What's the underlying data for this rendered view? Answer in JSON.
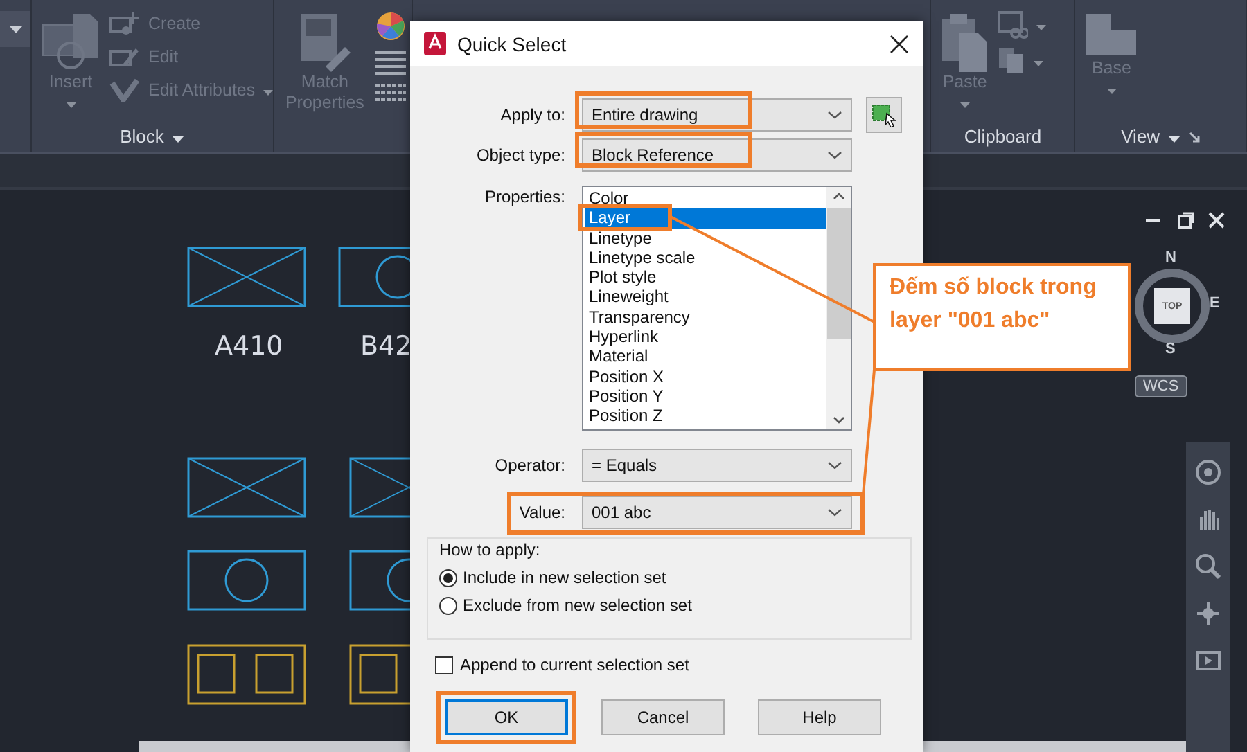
{
  "ribbon": {
    "panels": [
      {
        "title": "Block",
        "has_menu": true,
        "launcher": false,
        "items": [
          {
            "kind": "large",
            "label": "Insert",
            "has_menu": true
          },
          {
            "kind": "small",
            "label": "Create",
            "has_menu": false
          },
          {
            "kind": "small",
            "label": "Edit",
            "has_menu": false
          },
          {
            "kind": "small",
            "label": "Edit Attributes",
            "has_menu": true
          }
        ]
      },
      {
        "has_menu": false,
        "launcher": false,
        "items": [
          {
            "kind": "large",
            "label": "Match Properties",
            "has_menu": false
          }
        ]
      },
      {
        "title": "Clipboard",
        "has_menu": false,
        "launcher": false,
        "items": [
          {
            "kind": "large",
            "label": "Paste",
            "has_menu": true
          },
          {
            "kind": "icon",
            "has_menu": true
          },
          {
            "kind": "icon",
            "has_menu": true
          }
        ]
      },
      {
        "title": "View",
        "has_menu": true,
        "launcher": true,
        "items": [
          {
            "kind": "large",
            "label": "Base",
            "has_menu": true
          }
        ]
      }
    ]
  },
  "drawing": {
    "labels": [
      "A410",
      "B42"
    ]
  },
  "view_cube": {
    "north": "N",
    "east": "E",
    "south": "S",
    "face": "TOP",
    "ucs": "WCS"
  },
  "dialog": {
    "title": "Quick Select",
    "apply_to": {
      "label": "Apply to:",
      "value": "Entire drawing",
      "highlighted": true
    },
    "object_type": {
      "label": "Object type:",
      "value": "Block Reference",
      "highlighted": true
    },
    "properties": {
      "label": "Properties:",
      "items": [
        {
          "label": "Color",
          "selected": false,
          "highlighted": false
        },
        {
          "label": "Layer",
          "selected": true,
          "highlighted": true
        },
        {
          "label": "Linetype",
          "selected": false,
          "highlighted": false
        },
        {
          "label": "Linetype scale",
          "selected": false,
          "highlighted": false
        },
        {
          "label": "Plot style",
          "selected": false,
          "highlighted": false
        },
        {
          "label": "Lineweight",
          "selected": false,
          "highlighted": false
        },
        {
          "label": "Transparency",
          "selected": false,
          "highlighted": false
        },
        {
          "label": "Hyperlink",
          "selected": false,
          "highlighted": false
        },
        {
          "label": "Material",
          "selected": false,
          "highlighted": false
        },
        {
          "label": "Position X",
          "selected": false,
          "highlighted": false
        },
        {
          "label": "Position Y",
          "selected": false,
          "highlighted": false
        },
        {
          "label": "Position Z",
          "selected": false,
          "highlighted": false
        }
      ]
    },
    "operator": {
      "label": "Operator:",
      "value": "= Equals",
      "highlighted": false
    },
    "value": {
      "label": "Value:",
      "value": "001 abc",
      "highlighted": true
    },
    "how_to_apply": {
      "title": "How to apply:",
      "options": [
        {
          "label": "Include in new selection set",
          "selected": true
        },
        {
          "label": "Exclude from new selection set",
          "selected": false
        }
      ]
    },
    "append": {
      "label": "Append to current selection set",
      "checked": false
    },
    "buttons": [
      {
        "label": "OK",
        "default": true,
        "highlighted": true
      },
      {
        "label": "Cancel",
        "default": false,
        "highlighted": false
      },
      {
        "label": "Help",
        "default": false,
        "highlighted": false
      }
    ]
  },
  "callout": {
    "text": "Đếm số block trong layer \"001 abc\""
  }
}
